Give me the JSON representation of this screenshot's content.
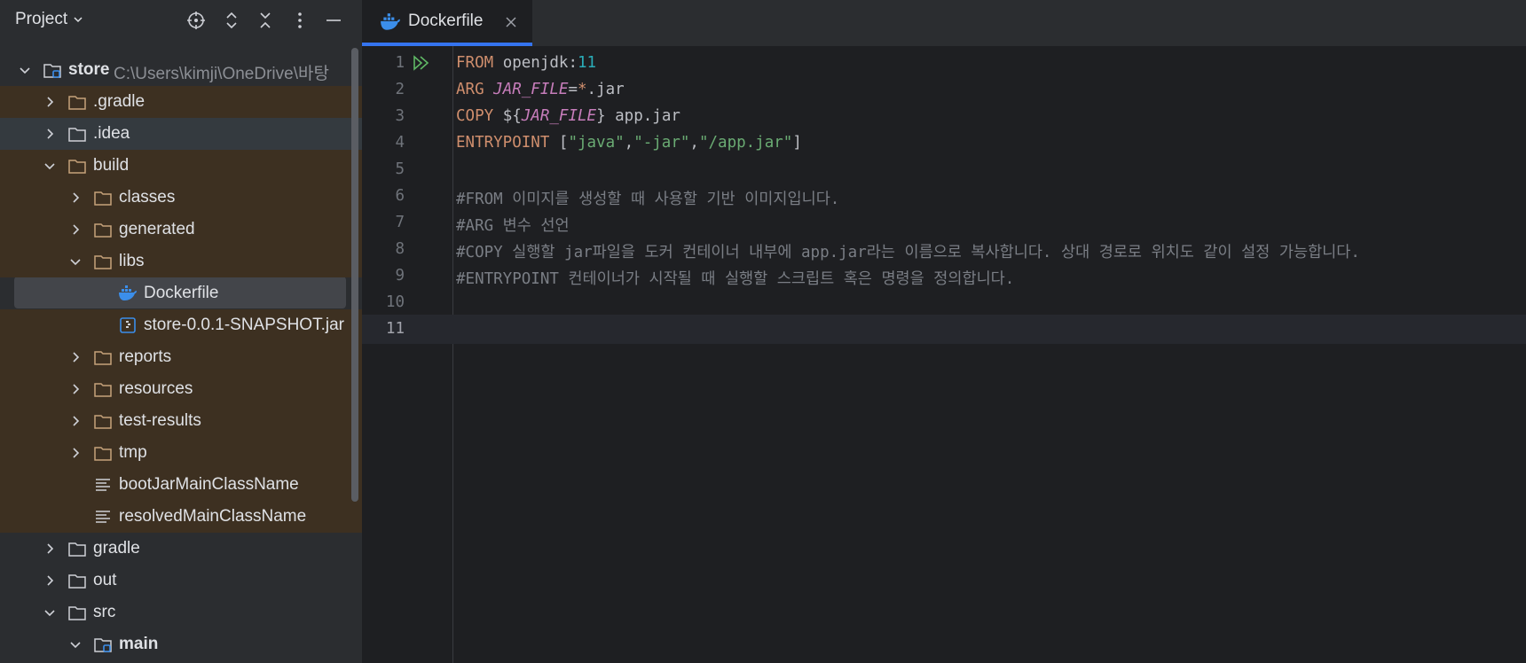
{
  "sidebar": {
    "title": "Project",
    "tree": [
      {
        "label": "store",
        "path": "C:\\Users\\kimji\\OneDrive\\바탕"
      },
      {
        "label": ".gradle"
      },
      {
        "label": ".idea"
      },
      {
        "label": "build"
      },
      {
        "label": "classes"
      },
      {
        "label": "generated"
      },
      {
        "label": "libs"
      },
      {
        "label": "Dockerfile"
      },
      {
        "label": "store-0.0.1-SNAPSHOT.jar"
      },
      {
        "label": "reports"
      },
      {
        "label": "resources"
      },
      {
        "label": "test-results"
      },
      {
        "label": "tmp"
      },
      {
        "label": "bootJarMainClassName"
      },
      {
        "label": "resolvedMainClassName"
      },
      {
        "label": "gradle"
      },
      {
        "label": "out"
      },
      {
        "label": "src"
      },
      {
        "label": "main"
      }
    ]
  },
  "editor": {
    "tab_label": "Dockerfile",
    "line_numbers": [
      "1",
      "2",
      "3",
      "4",
      "5",
      "6",
      "7",
      "8",
      "9",
      "10",
      "11"
    ],
    "lines": [
      [
        {
          "t": "kw",
          "v": "FROM"
        },
        {
          "t": "plain",
          "v": " openjdk:"
        },
        {
          "t": "num",
          "v": "11"
        }
      ],
      [
        {
          "t": "kw",
          "v": "ARG"
        },
        {
          "t": "plain",
          "v": " "
        },
        {
          "t": "var",
          "v": "JAR_FILE"
        },
        {
          "t": "plain",
          "v": "="
        },
        {
          "t": "kw",
          "v": "*"
        },
        {
          "t": "plain",
          "v": ".jar"
        }
      ],
      [
        {
          "t": "kw",
          "v": "COPY"
        },
        {
          "t": "plain",
          "v": " ${"
        },
        {
          "t": "var",
          "v": "JAR_FILE"
        },
        {
          "t": "plain",
          "v": "} app.jar"
        }
      ],
      [
        {
          "t": "kw",
          "v": "ENTRYPOINT"
        },
        {
          "t": "plain",
          "v": " ["
        },
        {
          "t": "str",
          "v": "\"java\""
        },
        {
          "t": "plain",
          "v": ","
        },
        {
          "t": "str",
          "v": "\"-jar\""
        },
        {
          "t": "plain",
          "v": ","
        },
        {
          "t": "str",
          "v": "\"/app.jar\""
        },
        {
          "t": "plain",
          "v": "]"
        }
      ],
      [],
      [
        {
          "t": "cm",
          "v": "#FROM 이미지를 생성할 때 사용할 기반 이미지입니다."
        }
      ],
      [
        {
          "t": "cm",
          "v": "#ARG 변수 선언"
        }
      ],
      [
        {
          "t": "cm",
          "v": "#COPY 실행할 jar파일을 도커 컨테이너 내부에 app.jar라는 이름으로 복사합니다. 상대 경로로 위치도 같이 설정 가능합니다."
        }
      ],
      [
        {
          "t": "cm",
          "v": "#ENTRYPOINT 컨테이너가 시작될 때 실행할 스크립트 혹은 명령을 정의합니다."
        }
      ],
      [],
      []
    ]
  },
  "colors": {
    "keyword": "#cf8e6d",
    "variable": "#c77dbb",
    "string": "#6aab73",
    "number": "#2aacb8",
    "comment": "#7a7e85",
    "folder_icon": "#c6a27a",
    "docker_icon": "#3b8eea",
    "run_icon": "#5fb865"
  }
}
